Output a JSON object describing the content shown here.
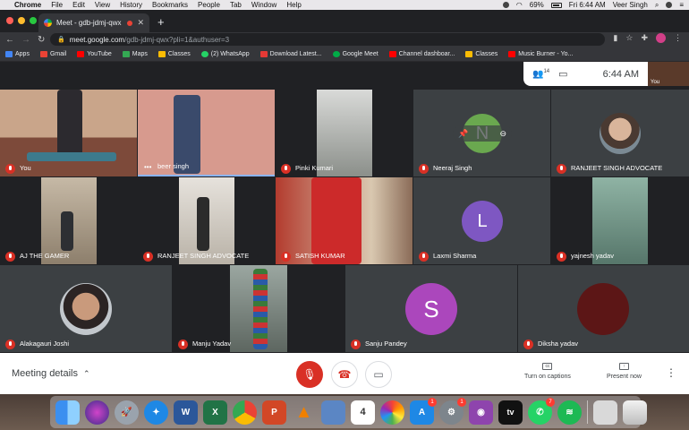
{
  "menubar": {
    "items": [
      "Chrome",
      "File",
      "Edit",
      "View",
      "History",
      "Bookmarks",
      "People",
      "Tab",
      "Window",
      "Help"
    ],
    "battery": "69%",
    "datetime": "Fri 6:44 AM",
    "user": "Veer Singh"
  },
  "browser": {
    "tab_title": "Meet - gdb-jdmj-qwx",
    "new_tab": "+",
    "url_domain": "meet.google.com",
    "url_path": "/gdb-jdmj-qwx?pli=1&authuser=3"
  },
  "bookmarks": [
    {
      "label": "Apps",
      "color": "#4285f4"
    },
    {
      "label": "Gmail",
      "color": "#ea4335"
    },
    {
      "label": "YouTube",
      "color": "#ff0000"
    },
    {
      "label": "Maps",
      "color": "#34a853"
    },
    {
      "label": "Classes",
      "color": "#fbbc04"
    },
    {
      "label": "(2) WhatsApp",
      "color": "#25d366"
    },
    {
      "label": "Download Latest...",
      "color": "#e53935"
    },
    {
      "label": "Google Meet",
      "color": "#00ac47"
    },
    {
      "label": "Channel dashboar...",
      "color": "#ff0000"
    },
    {
      "label": "Classes",
      "color": "#fbbc04"
    },
    {
      "label": "Music Burner - Yo...",
      "color": "#ff0000"
    }
  ],
  "meet": {
    "participant_count": "14",
    "time": "6:44 AM",
    "self_label": "You",
    "participants": [
      "You",
      "beer singh",
      "Pinki Kumari",
      "Neeraj Singh",
      "RANJEET SINGH ADVOCATE",
      "AJ THE GAMER",
      "RANJEET SINGH ADVOCATE",
      "SATISH KUMAR",
      "Laxmi Sharma",
      "yajnesh yadav",
      "Alakagauri Joshi",
      "Manju Yadav",
      "Sanju Pandey",
      "Diksha yadav"
    ],
    "avatar_letters": {
      "neeraj": "N",
      "laxmi": "L",
      "sanju": "S"
    },
    "meeting_details": "Meeting details",
    "captions_label": "Turn on captions",
    "present_label": "Present now"
  },
  "dock": {
    "badges": {
      "appstore": "1",
      "settings": "1",
      "whatsapp": "7"
    },
    "calendar_day": "4",
    "appletv": "tv"
  }
}
